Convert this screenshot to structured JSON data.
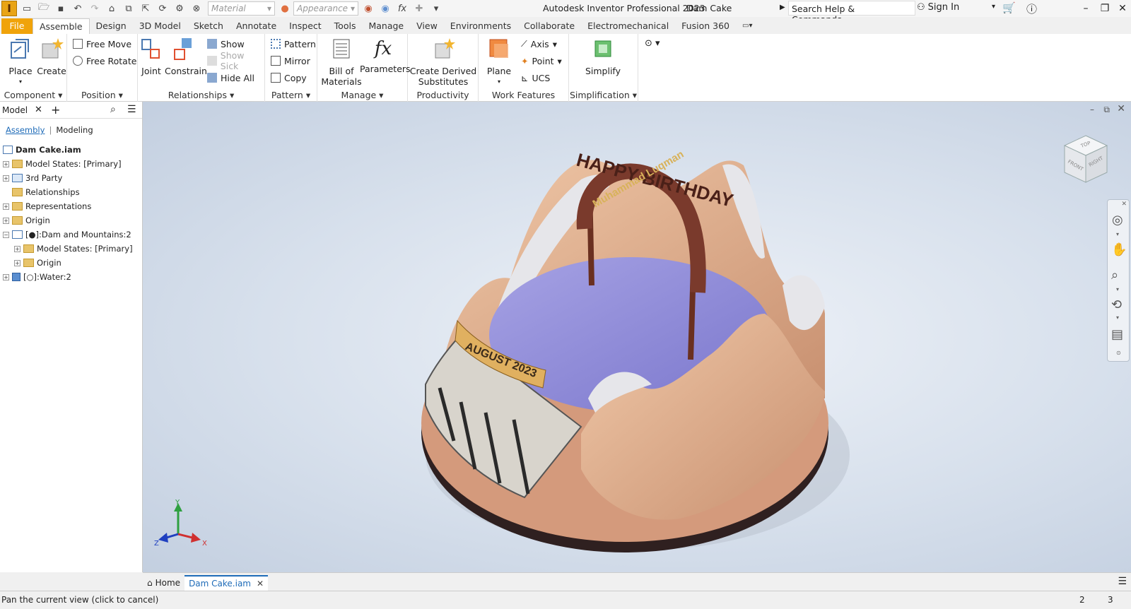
{
  "app": {
    "title": "Autodesk Inventor Professional 2023",
    "document": "Dam Cake",
    "logo": "I"
  },
  "qat": {
    "material_placeholder": "Material",
    "appearance_placeholder": "Appearance",
    "search_placeholder": "Search Help & Commands...",
    "sign_in": "Sign In"
  },
  "tabs": [
    "File",
    "Assemble",
    "Design",
    "3D Model",
    "Sketch",
    "Annotate",
    "Inspect",
    "Tools",
    "Manage",
    "View",
    "Environments",
    "Collaborate",
    "Electromechanical",
    "Fusion 360"
  ],
  "active_tab": "Assemble",
  "ribbon": {
    "component": {
      "label": "Component",
      "place": "Place",
      "create": "Create"
    },
    "position": {
      "label": "Position",
      "free_move": "Free Move",
      "free_rotate": "Free Rotate"
    },
    "relationships": {
      "label": "Relationships",
      "joint": "Joint",
      "constrain": "Constrain",
      "show": "Show",
      "show_sick": "Show Sick",
      "hide_all": "Hide All"
    },
    "pattern": {
      "label": "Pattern",
      "pattern": "Pattern",
      "mirror": "Mirror",
      "copy": "Copy"
    },
    "manage": {
      "label": "Manage",
      "bom_line1": "Bill of",
      "bom_line2": "Materials",
      "parameters": "Parameters"
    },
    "productivity": {
      "label": "Productivity",
      "cds_line1": "Create Derived",
      "cds_line2": "Substitutes"
    },
    "work_features": {
      "label": "Work Features",
      "plane": "Plane",
      "axis": "Axis",
      "point": "Point",
      "ucs": "UCS"
    },
    "simplification": {
      "label": "Simplification",
      "simplify": "Simplify"
    }
  },
  "browser": {
    "tab_label": "Model",
    "assembly_link": "Assembly",
    "modeling_link": "Modeling",
    "root": "Dam Cake.iam",
    "items": [
      {
        "label": "Model States: [Primary]",
        "indent": 0,
        "expander": "+",
        "icon": "folder-icon"
      },
      {
        "label": "3rd Party",
        "indent": 0,
        "expander": "+",
        "icon": "third-party-icon"
      },
      {
        "label": "Relationships",
        "indent": 0,
        "expander": "",
        "icon": "folder-icon"
      },
      {
        "label": "Representations",
        "indent": 0,
        "expander": "+",
        "icon": "representations-icon"
      },
      {
        "label": "Origin",
        "indent": 0,
        "expander": "+",
        "icon": "folder-icon"
      },
      {
        "label": "[●]:Dam and Mountains:2",
        "indent": 0,
        "expander": "−",
        "icon": "subassembly-icon"
      },
      {
        "label": "Model States: [Primary]",
        "indent": 1,
        "expander": "+",
        "icon": "folder-icon"
      },
      {
        "label": "Origin",
        "indent": 1,
        "expander": "+",
        "icon": "folder-icon"
      },
      {
        "label": "[○]:Water:2",
        "indent": 0,
        "expander": "+",
        "icon": "part-icon"
      }
    ]
  },
  "viewcube": {
    "top": "TOP",
    "front": "FRONT",
    "right": "RIGHT"
  },
  "triad": {
    "x": "X",
    "y": "Y",
    "z": "Z"
  },
  "model_text": {
    "arch_top": "HAPPY BIRTHDAY",
    "arch_name": "Muhammad Luqman",
    "plaque": "AUGUST 2023"
  },
  "doc_tabs": {
    "home": "Home",
    "active": "Dam Cake.iam"
  },
  "status": {
    "message": "Pan the current view (click to cancel)",
    "count1": "2",
    "count2": "3"
  },
  "colors": {
    "file_tab": "#f0a30a",
    "accent_link": "#1e6bb8",
    "water": "#8a86d6",
    "mountain": "#d9a988",
    "snow": "#e8e8ea",
    "base_dark": "#3a2a2a",
    "arch": "#7a3a2c",
    "arch_text": "#d8b25a"
  }
}
